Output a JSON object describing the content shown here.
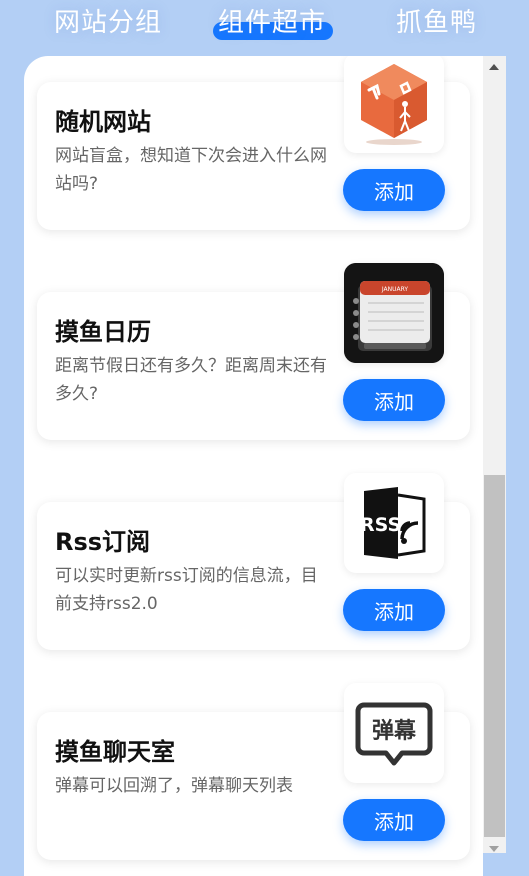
{
  "tabs": [
    {
      "label": "网站分组",
      "active": false
    },
    {
      "label": "组件超市",
      "active": true
    },
    {
      "label": "抓鱼鸭",
      "active": false
    }
  ],
  "accent_color": "#1677ff",
  "widgets": [
    {
      "title": "随机网站",
      "description": "网站盲盒，想知道下次会进入什么网站吗?",
      "icon": "random-site-cube-icon",
      "button": "添加"
    },
    {
      "title": "摸鱼日历",
      "description": "距离节假日还有多久？距离周末还有多久?",
      "icon": "calendar-icon",
      "calendar_header": "JANUARY",
      "button": "添加"
    },
    {
      "title": "Rss订阅",
      "description": "可以实时更新rss订阅的信息流，目前支持rss2.0",
      "icon": "rss-icon",
      "icon_text": "RSS",
      "button": "添加"
    },
    {
      "title": "摸鱼聊天室",
      "description": "弹幕可以回溯了，弹幕聊天列表",
      "icon": "danmaku-bubble-icon",
      "icon_text": "弹幕",
      "button": "添加"
    }
  ]
}
